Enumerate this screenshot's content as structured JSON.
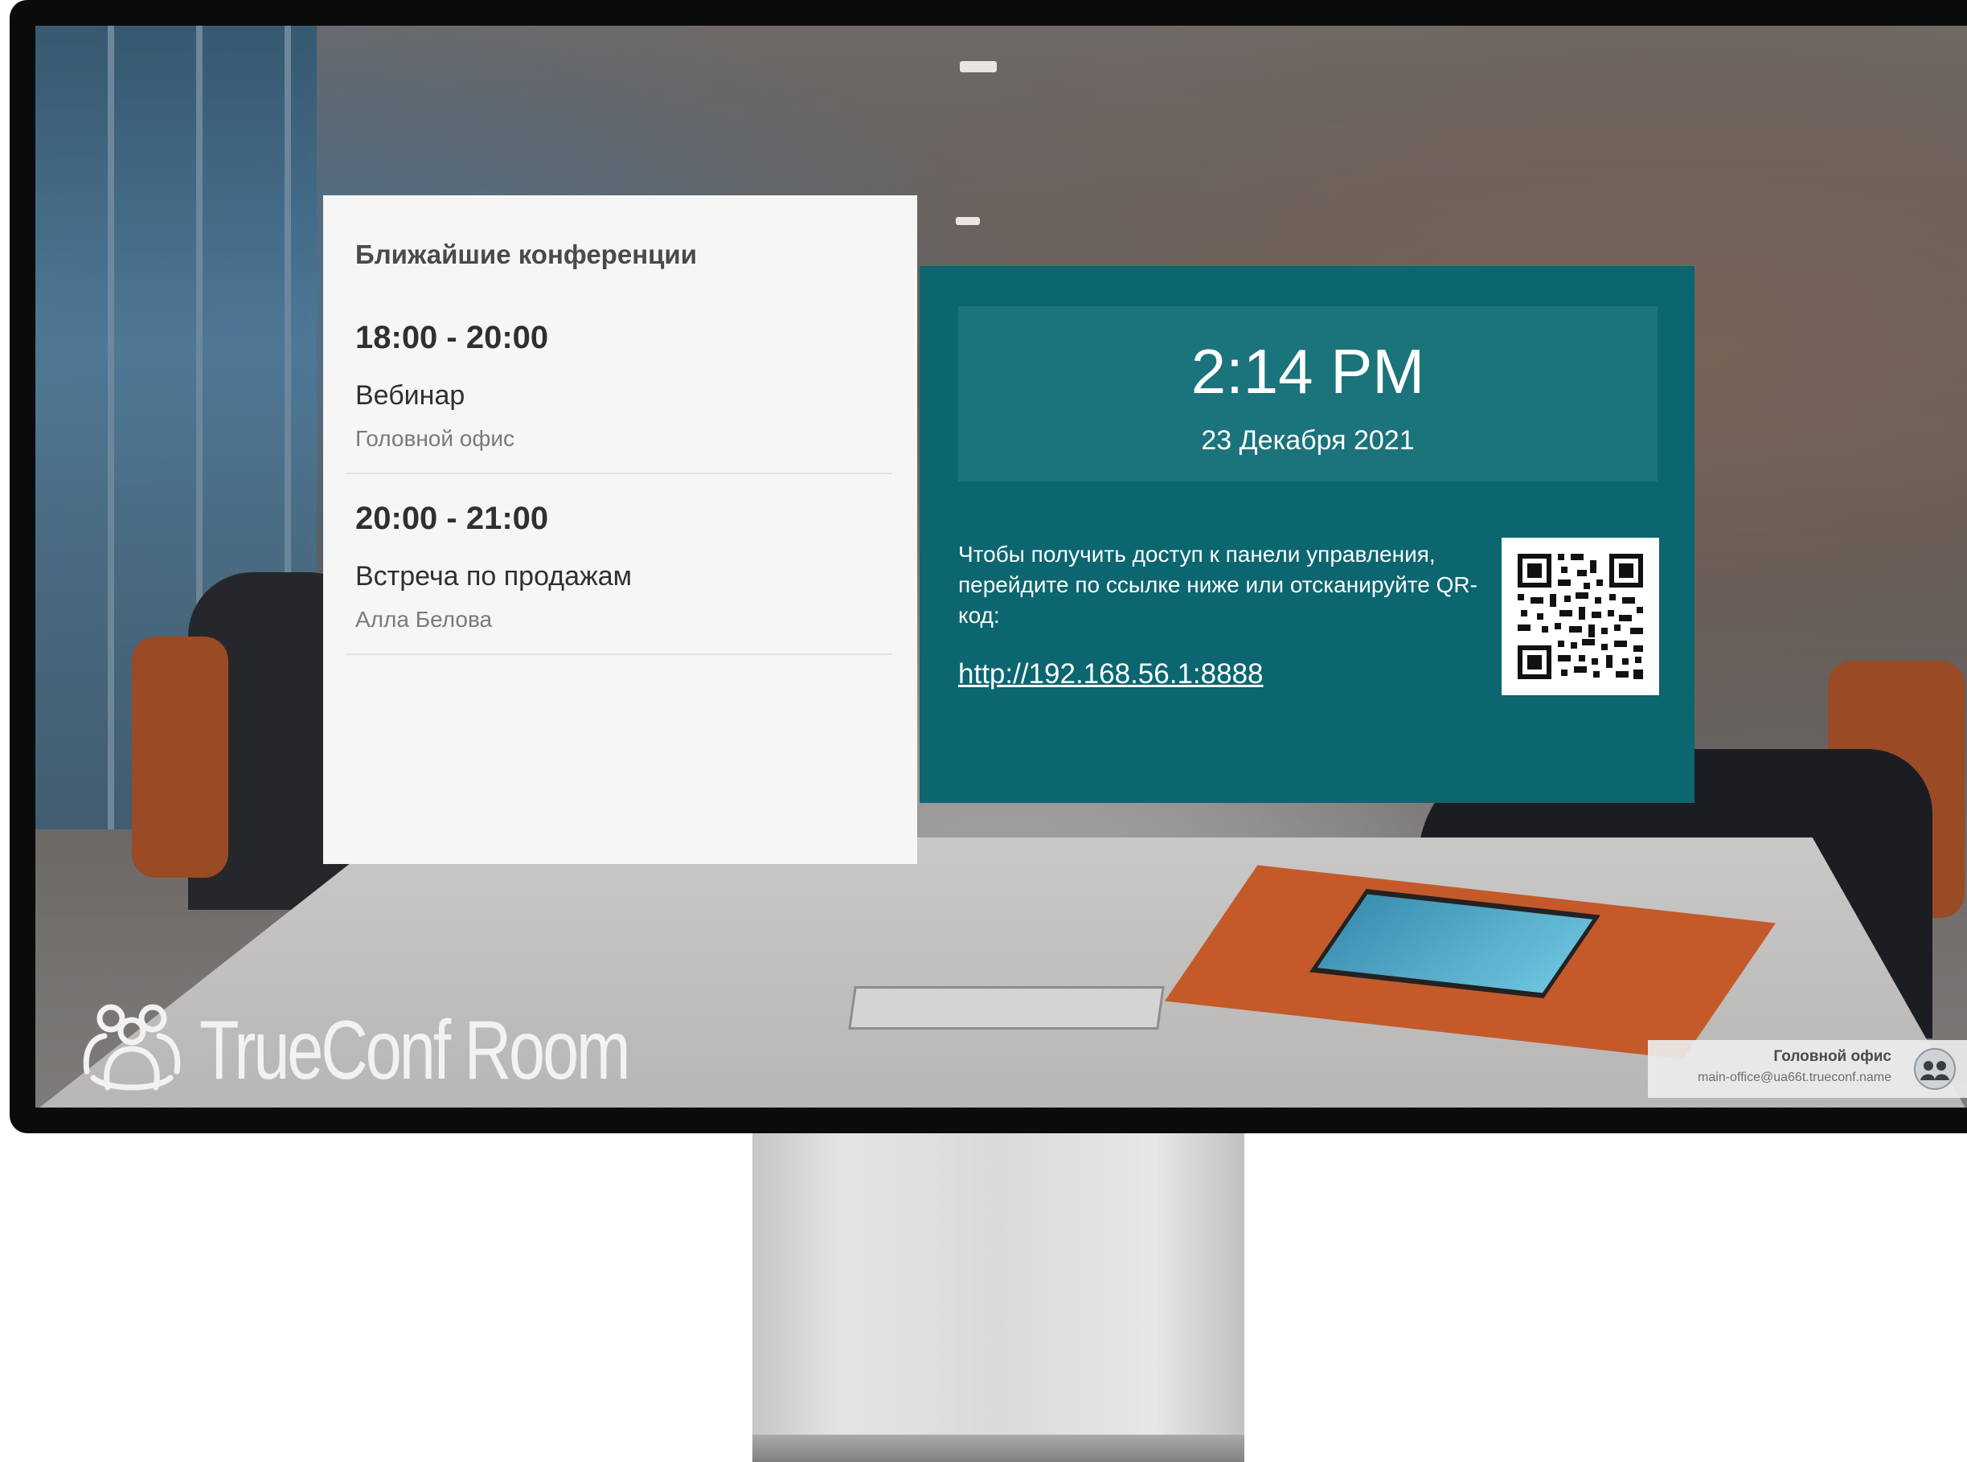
{
  "conferences": {
    "title": "Ближайшие конференции",
    "items": [
      {
        "time": "18:00 - 20:00",
        "name": "Вебинар",
        "place": "Головной офис"
      },
      {
        "time": "20:00 - 21:00",
        "name": "Встреча по продажам",
        "place": "Алла Белова"
      }
    ]
  },
  "clock": {
    "time": "2:14 PM",
    "date": "23 Декабря 2021"
  },
  "access": {
    "text": "Чтобы получить доступ к панели управления, перейдите по ссылке ниже или отсканируйте QR-код:",
    "link": "http://192.168.56.1:8888",
    "qr_icon": "qr-code-icon"
  },
  "brand": {
    "name": "TrueConf Room",
    "logo_icon": "trueconf-people-logo-icon"
  },
  "account": {
    "name": "Головной офис",
    "email": "main-office@ua66t.trueconf.name",
    "avatar_icon": "avatar-icon"
  },
  "colors": {
    "panel_teal": "#0b6670",
    "clock_box_teal": "#1b737c",
    "card_background": "#f6f6f6"
  }
}
